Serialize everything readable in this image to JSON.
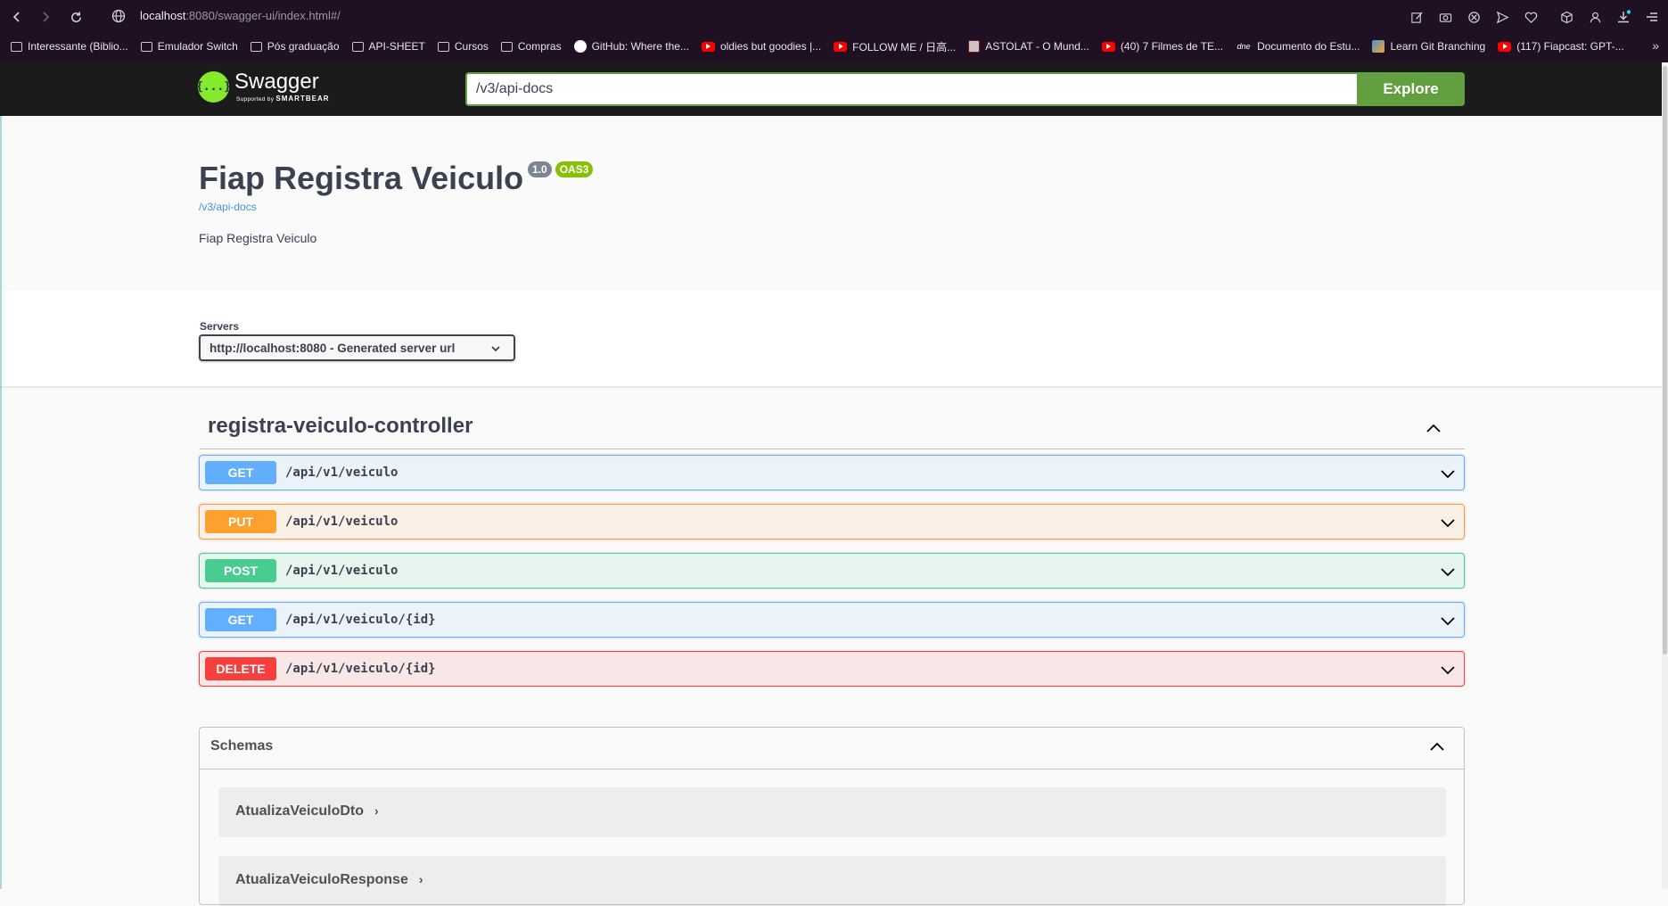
{
  "browser": {
    "url_host": "localhost",
    "url_rest": ":8080/swagger-ui/index.html#/",
    "bookmarks": [
      {
        "label": "Interessante (Biblio...",
        "icon": "folder-icon"
      },
      {
        "label": "Emulador Switch",
        "icon": "folder-icon"
      },
      {
        "label": "Pós graduação",
        "icon": "folder-icon"
      },
      {
        "label": "API-SHEET",
        "icon": "folder-icon"
      },
      {
        "label": "Cursos",
        "icon": "folder-icon"
      },
      {
        "label": "Compras",
        "icon": "folder-icon"
      },
      {
        "label": "GitHub: Where the...",
        "icon": "github-icon"
      },
      {
        "label": "oldies but goodies |...",
        "icon": "youtube-icon"
      },
      {
        "label": "FOLLOW ME / 日高...",
        "icon": "youtube-icon"
      },
      {
        "label": "ASTOLAT - O Mund...",
        "icon": "astolat-icon"
      },
      {
        "label": "(40) 7 Filmes de TE...",
        "icon": "youtube-icon"
      },
      {
        "label": "Documento do Estu...",
        "icon": "dne-icon"
      },
      {
        "label": "Learn Git Branching",
        "icon": "learn-git-icon"
      },
      {
        "label": "(117) Fiapcast: GPT-...",
        "icon": "youtube-icon"
      }
    ],
    "dne_text": "dne"
  },
  "topbar": {
    "logo_name": "Swagger",
    "logo_supported": "Supported by",
    "logo_brand": "SMARTBEAR",
    "logo_glyph": "{...}",
    "search_value": "/v3/api-docs",
    "explore_label": "Explore"
  },
  "info": {
    "title": "Fiap Registra Veiculo",
    "version": "1.0",
    "oas": "OAS3",
    "spec_link": "/v3/api-docs",
    "description": "Fiap Registra Veiculo"
  },
  "servers": {
    "label": "Servers",
    "selected": "http://localhost:8080 - Generated server url"
  },
  "tag": {
    "name": "registra-veiculo-controller",
    "operations": [
      {
        "method": "GET",
        "path": "/api/v1/veiculo",
        "type": "get"
      },
      {
        "method": "PUT",
        "path": "/api/v1/veiculo",
        "type": "put"
      },
      {
        "method": "POST",
        "path": "/api/v1/veiculo",
        "type": "post"
      },
      {
        "method": "GET",
        "path": "/api/v1/veiculo/{id}",
        "type": "get"
      },
      {
        "method": "DELETE",
        "path": "/api/v1/veiculo/{id}",
        "type": "delete"
      }
    ]
  },
  "schemas": {
    "title": "Schemas",
    "models": [
      "AtualizaVeiculoDto",
      "AtualizaVeiculoResponse"
    ]
  },
  "colors": {
    "get": "#61affe",
    "put": "#fca130",
    "post": "#49cc90",
    "delete": "#f93e3e",
    "swagger_green": "#85ea2d",
    "explore_green": "#62a03f"
  }
}
